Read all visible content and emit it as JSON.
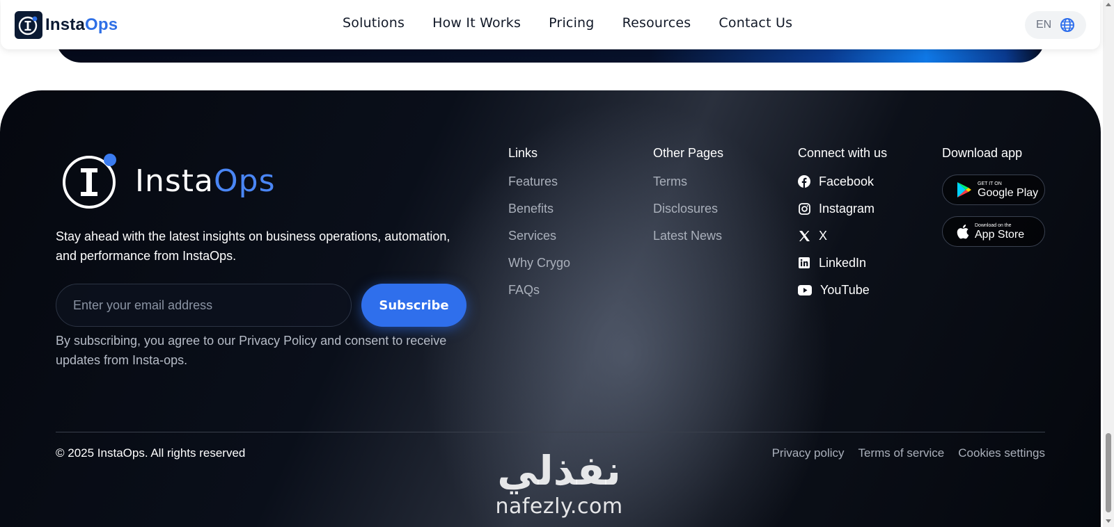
{
  "header": {
    "brand": {
      "prefix": "Insta",
      "accent": "Ops"
    },
    "nav": [
      "Solutions",
      "How It Works",
      "Pricing",
      "Resources",
      "Contact Us"
    ],
    "language": "EN"
  },
  "footer": {
    "logo": {
      "prefix": "Insta",
      "accent": "Ops"
    },
    "tagline": "Stay ahead with the latest insights on business operations, automation, and performance from InstaOps.",
    "email_placeholder": "Enter your email address",
    "subscribe_label": "Subscribe",
    "consent": "By subscribing, you agree to our Privacy Policy and consent to receive updates from Insta-ops.",
    "columns": {
      "links": {
        "title": "Links",
        "items": [
          "Features",
          "Benefits",
          "Services",
          "Why Crygo",
          "FAQs"
        ]
      },
      "other_pages": {
        "title": "Other Pages",
        "items": [
          "Terms",
          "Disclosures",
          "Latest News"
        ]
      },
      "connect": {
        "title": "Connect with us",
        "items": [
          {
            "label": "Facebook",
            "icon": "facebook-icon"
          },
          {
            "label": "Instagram",
            "icon": "instagram-icon"
          },
          {
            "label": "X",
            "icon": "x-icon"
          },
          {
            "label": "LinkedIn",
            "icon": "linkedin-icon"
          },
          {
            "label": "YouTube",
            "icon": "youtube-icon"
          }
        ]
      },
      "download": {
        "title": "Download app",
        "google_play": {
          "small": "GET IT ON",
          "big": "Google Play"
        },
        "app_store": {
          "small": "Download on the",
          "big": "App Store"
        }
      }
    },
    "copyright": "© 2025 InstaOps. All rights reserved",
    "legal": [
      "Privacy policy",
      "Terms of service",
      "Cookies settings"
    ],
    "watermark": {
      "arabic": "نفذلي",
      "latin": "nafezly.com"
    }
  },
  "colors": {
    "accent": "#2f6fec",
    "footer_bg": "#0a0f1a",
    "brand_dark": "#0b1a33"
  }
}
